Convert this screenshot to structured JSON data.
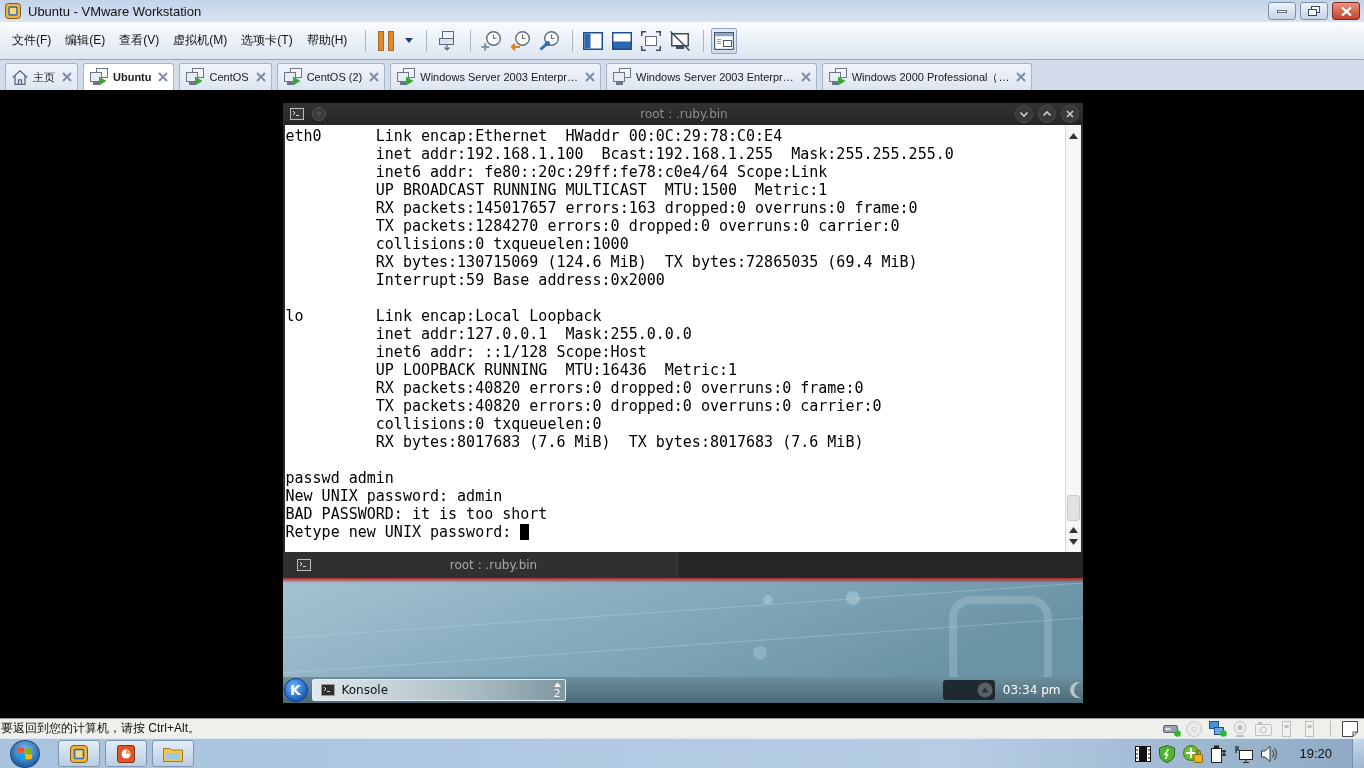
{
  "window": {
    "title": "Ubuntu - VMware Workstation"
  },
  "menu": [
    "文件(F)",
    "编辑(E)",
    "查看(V)",
    "虚拟机(M)",
    "选项卡(T)",
    "帮助(H)"
  ],
  "toolbar": {
    "groups": [
      {
        "buttons": [
          {
            "kind": "pause",
            "pressed": false
          },
          {
            "kind": "caret",
            "pressed": false
          }
        ]
      },
      {
        "buttons": [
          {
            "kind": "computers",
            "pressed": false
          }
        ]
      },
      {
        "buttons": [
          {
            "kind": "clockplus",
            "pressed": false
          },
          {
            "kind": "clockback",
            "pressed": false
          },
          {
            "kind": "clockwrench",
            "pressed": false
          }
        ]
      },
      {
        "buttons": [
          {
            "kind": "sidebar",
            "pressed": false
          },
          {
            "kind": "bottombar",
            "pressed": false
          },
          {
            "kind": "brackets",
            "pressed": false
          },
          {
            "kind": "crossed",
            "pressed": false
          }
        ]
      },
      {
        "buttons": [
          {
            "kind": "window",
            "pressed": true
          }
        ]
      }
    ]
  },
  "tabs": [
    {
      "kind": "home",
      "label": "主页",
      "selected": false
    },
    {
      "kind": "vm",
      "label": "Ubuntu",
      "selected": true,
      "running": true
    },
    {
      "kind": "vm",
      "label": "CentOS",
      "selected": false,
      "running": true
    },
    {
      "kind": "vm",
      "label": "CentOS (2)",
      "selected": false,
      "running": true
    },
    {
      "kind": "vm",
      "label": "Windows Server 2003 Enterpr…",
      "selected": false,
      "running": true
    },
    {
      "kind": "vm",
      "label": "Windows Server 2003 Enterpr…",
      "selected": false,
      "running": false
    },
    {
      "kind": "vm",
      "label": "Windows 2000 Professional（…",
      "selected": false,
      "running": true
    }
  ],
  "vm_screen": {
    "konsole": {
      "title": "root : .ruby.bin",
      "interfaces": [
        {
          "name": "eth0",
          "lines": [
            "Link encap:Ethernet  HWaddr 00:0C:29:78:C0:E4",
            "inet addr:192.168.1.100  Bcast:192.168.1.255  Mask:255.255.255.0",
            "inet6 addr: fe80::20c:29ff:fe78:c0e4/64 Scope:Link",
            "UP BROADCAST RUNNING MULTICAST  MTU:1500  Metric:1",
            "RX packets:145017657 errors:163 dropped:0 overruns:0 frame:0",
            "TX packets:1284270 errors:0 dropped:0 overruns:0 carrier:0",
            "collisions:0 txqueuelen:1000",
            "RX bytes:130715069 (124.6 MiB)  TX bytes:72865035 (69.4 MiB)",
            "Interrupt:59 Base address:0x2000"
          ]
        },
        {
          "name": "lo",
          "lines": [
            "Link encap:Local Loopback",
            "inet addr:127.0.0.1  Mask:255.0.0.0",
            "inet6 addr: ::1/128 Scope:Host",
            "UP LOOPBACK RUNNING  MTU:16436  Metric:1",
            "RX packets:40820 errors:0 dropped:0 overruns:0 frame:0",
            "TX packets:40820 errors:0 dropped:0 overruns:0 carrier:0",
            "collisions:0 txqueuelen:0",
            "RX bytes:8017683 (7.6 MiB)  TX bytes:8017683 (7.6 MiB)"
          ]
        }
      ],
      "session": [
        "passwd admin",
        "New UNIX password: admin",
        "BAD PASSWORD: it is too short"
      ],
      "prompt": {
        "text": "Retype new UNIX password:",
        "cursor": true
      },
      "tabs": [
        {
          "label": "root : .ruby.bin",
          "selected": true
        }
      ]
    },
    "panel": {
      "launcher": "K",
      "tasks": [
        {
          "label": "Konsole",
          "count": "2"
        }
      ],
      "clock": "03:34 pm"
    }
  },
  "status_bar": {
    "message": "要返回到您的计算机，请按 Ctrl+Alt。",
    "devices": [
      {
        "kind": "disk",
        "connected": true
      },
      {
        "kind": "cd",
        "connected": false
      },
      {
        "kind": "network",
        "connected": true
      },
      {
        "kind": "webcam",
        "connected": false
      },
      {
        "kind": "camera",
        "connected": false
      },
      {
        "kind": "usb",
        "connected": false
      },
      {
        "kind": "usb",
        "connected": false
      }
    ]
  },
  "taskbar": {
    "clock": "19:20"
  }
}
